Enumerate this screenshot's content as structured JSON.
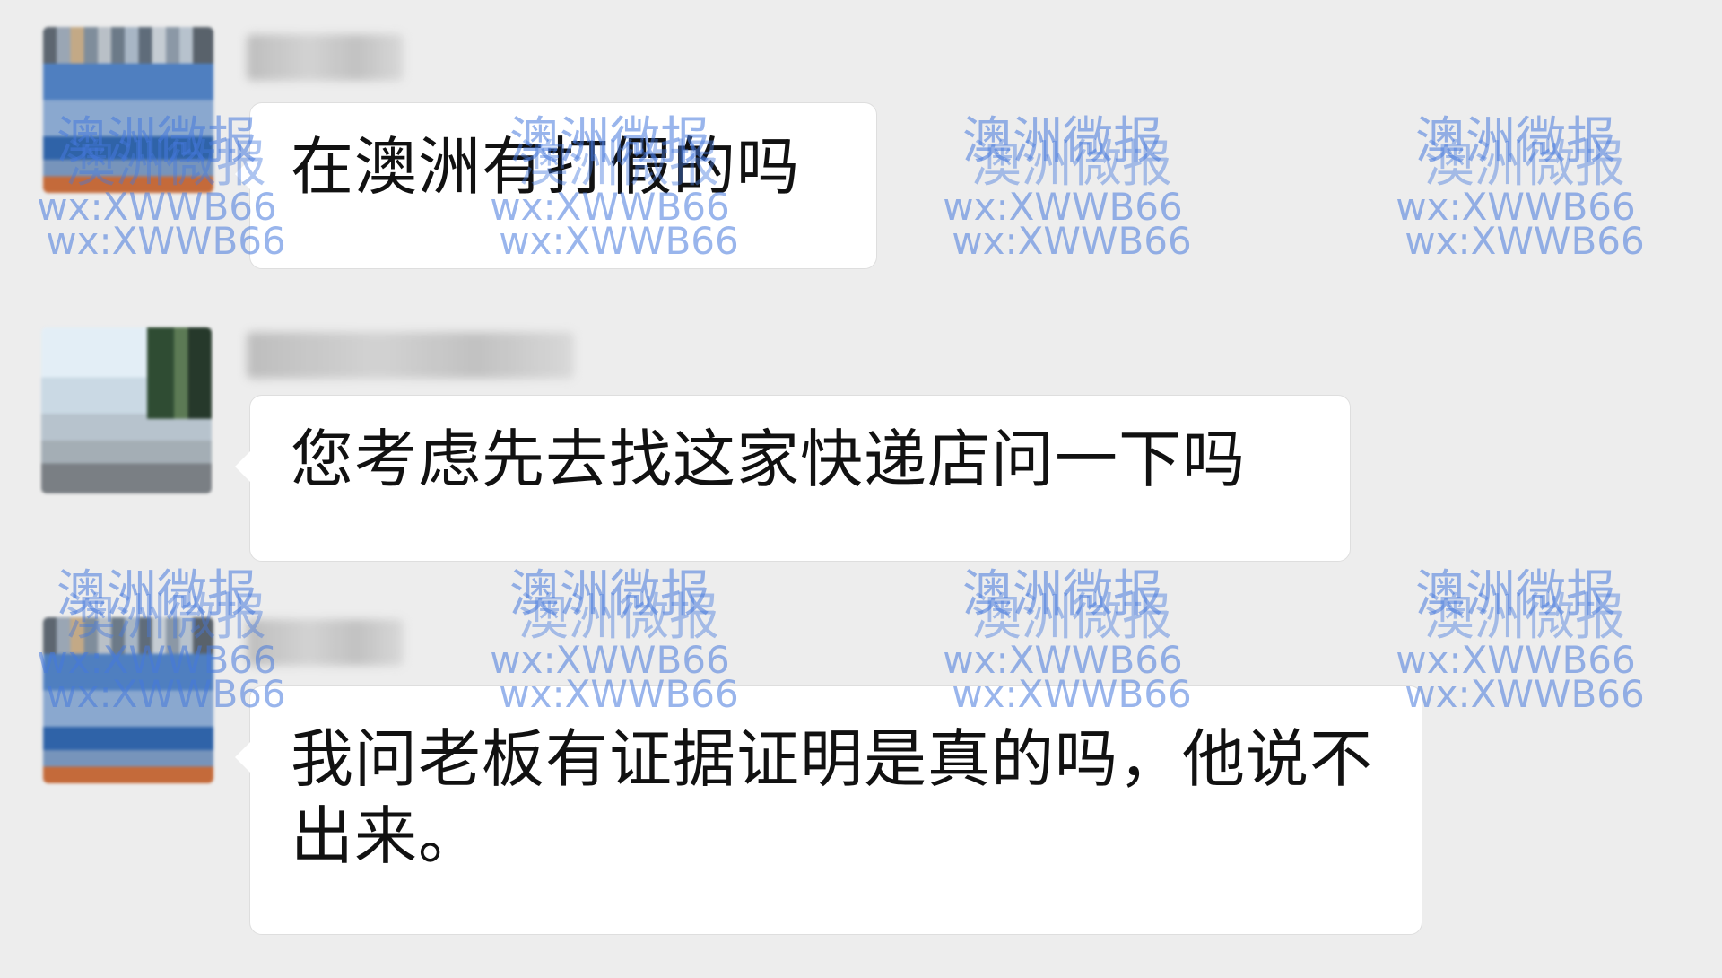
{
  "messages": [
    {
      "sender": "",
      "text": "在澳洲有打假的吗"
    },
    {
      "sender": "",
      "text": "您考虑先去找这家快递店问一下吗"
    },
    {
      "sender": "",
      "text": "我问老板有证据证明是真的吗，他说不出来。"
    }
  ],
  "watermark": {
    "cn": "澳洲微报",
    "en": "wx:XWWB66"
  }
}
